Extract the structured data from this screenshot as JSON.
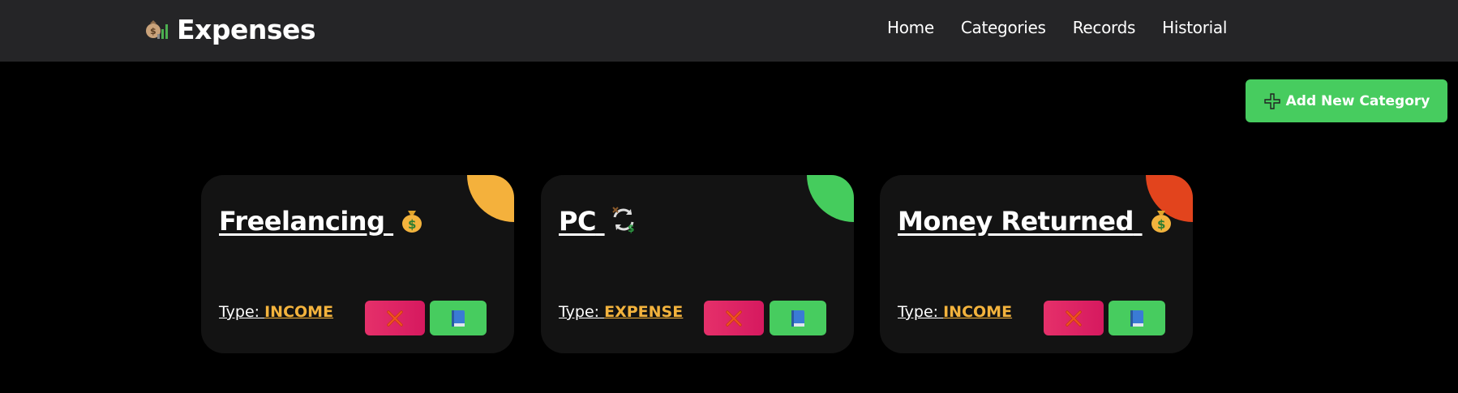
{
  "app": {
    "title": "Expenses"
  },
  "nav": [
    {
      "label": "Home"
    },
    {
      "label": "Categories"
    },
    {
      "label": "Records"
    },
    {
      "label": "Historial"
    }
  ],
  "actions": {
    "add_label": "Add New Category"
  },
  "type_prefix": "Type:",
  "cards": [
    {
      "title": "Freelancing",
      "icon": "money-bag-icon",
      "type": "INCOME",
      "corner_color": "#f4b13c"
    },
    {
      "title": "PC",
      "icon": "exchange-money-icon",
      "type": "EXPENSE",
      "corner_color": "#45cc5d"
    },
    {
      "title": "Money Returned",
      "icon": "money-bag-icon",
      "type": "INCOME",
      "corner_color": "#e2441d"
    }
  ],
  "colors": {
    "navbar": "#252527",
    "background": "#000000",
    "card": "#131313",
    "accent_green": "#47cc5f",
    "delete_pink": "#e12a66",
    "type_value": "#f3b33d"
  }
}
